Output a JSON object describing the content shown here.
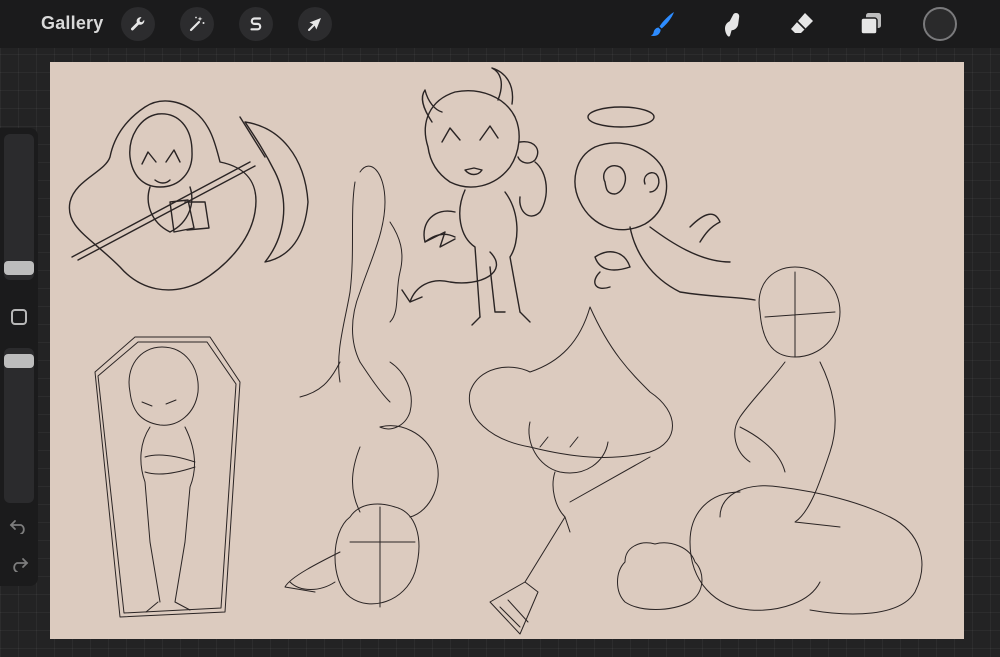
{
  "app": {
    "gallery_label": "Gallery"
  },
  "toolbar": {
    "left_tools": [
      {
        "name": "actions",
        "icon": "wrench-icon"
      },
      {
        "name": "adjustments",
        "icon": "magic-wand-icon"
      },
      {
        "name": "selection",
        "icon": "selection-s-icon"
      },
      {
        "name": "transform",
        "icon": "arrow-cursor-icon"
      }
    ],
    "right_tools": [
      {
        "name": "brush",
        "icon": "brush-icon",
        "active": true
      },
      {
        "name": "smudge",
        "icon": "smudge-finger-icon",
        "active": false
      },
      {
        "name": "eraser",
        "icon": "eraser-icon",
        "active": false
      },
      {
        "name": "layers",
        "icon": "layers-icon",
        "active": false
      }
    ],
    "current_color": "#2a2a2b"
  },
  "colors": {
    "canvas_bg": "#dccbbf",
    "accent_active": "#2d8cff",
    "toolbar_bg": "#1b1b1c",
    "workspace_bg": "#232324"
  },
  "sidebar": {
    "brush_size_level": 0.3,
    "brush_opacity_level": 0.95,
    "modify_button_icon": "square-icon",
    "undo_icon": "undo-arrow-icon",
    "redo_icon": "redo-arrow-icon"
  }
}
